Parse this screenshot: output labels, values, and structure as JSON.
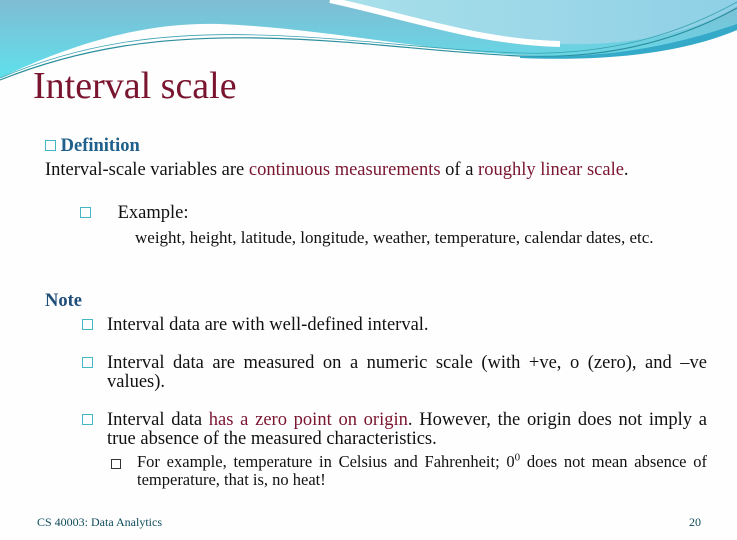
{
  "slide": {
    "title": "Interval scale",
    "definition": {
      "heading": "Definition",
      "text_parts": [
        {
          "text": "Interval-scale variables are ",
          "highlight": false
        },
        {
          "text": "continuous measurements",
          "highlight": true
        },
        {
          "text": " of a ",
          "highlight": false
        },
        {
          "text": "roughly linear scale",
          "highlight": true
        },
        {
          "text": ".",
          "highlight": false
        }
      ],
      "example_label": "Example:",
      "example_text": "weight, height, latitude, longitude, weather, temperature, calendar dates, etc."
    },
    "note": {
      "heading": "Note",
      "bullets": [
        {
          "text": "Interval data are with well-defined interval."
        },
        {
          "text": "Interval data are measured on a numeric scale (with +ve, o (zero), and –ve values)."
        },
        {
          "pre": "Interval data ",
          "highlight": "has a zero point on origin",
          "post": ". However, the origin does not imply a true absence of the measured characteristics.",
          "sub_bullet": {
            "pre": "For example, temperature in Celsius and Fahrenheit; 0",
            "sup": "0",
            "post": " does not mean absence of temperature, that is, no heat!"
          }
        }
      ]
    },
    "footer": {
      "course": "CS 40003: Data Analytics",
      "page_number": "20"
    },
    "colors": {
      "title": "#7a1530",
      "highlight": "#7a1530",
      "heading_blue": "#1f5f8b",
      "bullet_cyan": "#44b6c4",
      "footer": "#0e4b5a"
    }
  }
}
